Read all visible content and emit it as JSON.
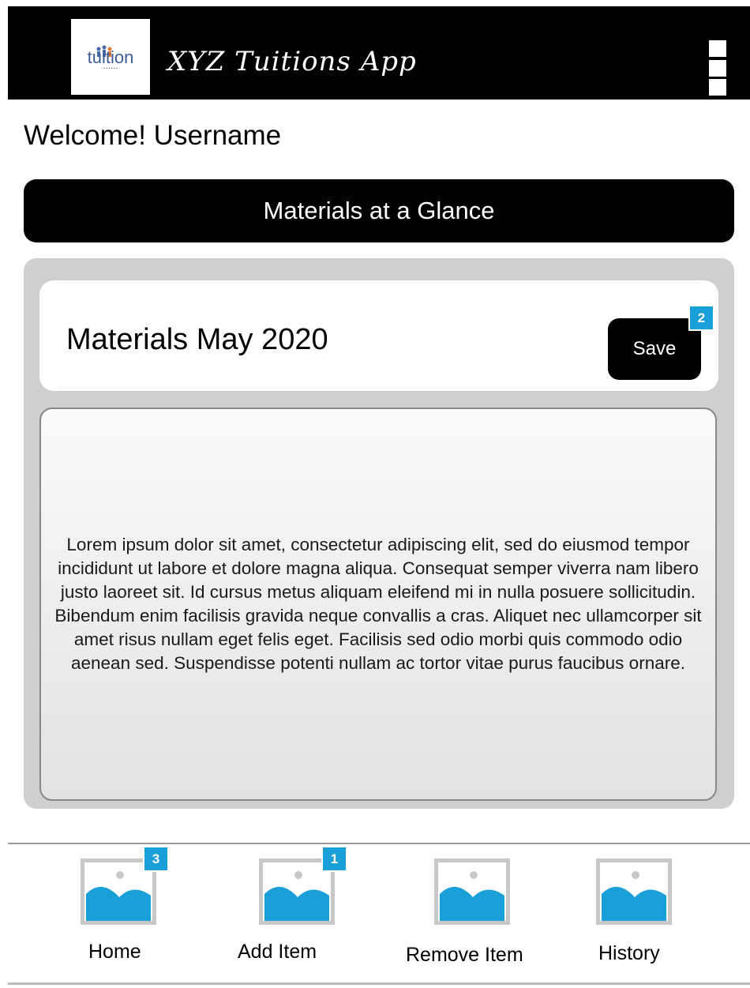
{
  "header": {
    "app_title": "XYZ Tuitions App",
    "logo_text": "tuition",
    "logo_icon": "tuition-logo"
  },
  "welcome": {
    "text": "Welcome! Username"
  },
  "section": {
    "title": "Materials at a Glance"
  },
  "card": {
    "title": "Materials May 2020",
    "save_label": "Save",
    "save_badge": "2",
    "body": "Lorem ipsum dolor sit amet, consectetur adipiscing elit, sed do eiusmod tempor incididunt ut labore et dolore magna aliqua. Consequat semper viverra nam libero justo laoreet sit. Id cursus metus aliquam eleifend mi in nulla posuere sollicitudin. Bibendum enim facilisis gravida neque convallis a cras. Aliquet nec ullamcorper sit amet risus nullam eget felis eget. Facilisis sed odio morbi quis commodo odio aenean sed. Suspendisse potenti nullam ac tortor vitae purus faucibus ornare."
  },
  "nav": {
    "items": [
      {
        "label": "Home",
        "badge": "3",
        "icon": "image-placeholder-icon"
      },
      {
        "label": "Add Item",
        "badge": "1",
        "icon": "image-placeholder-icon"
      },
      {
        "label": "Remove Item",
        "icon": "image-placeholder-icon"
      },
      {
        "label": "History",
        "icon": "image-placeholder-icon"
      }
    ]
  },
  "colors": {
    "header_bg": "#000000",
    "panel_bg": "#cfcfcf",
    "badge_bg": "#1a9fd9",
    "placeholder_blue": "#1a9fd9"
  }
}
